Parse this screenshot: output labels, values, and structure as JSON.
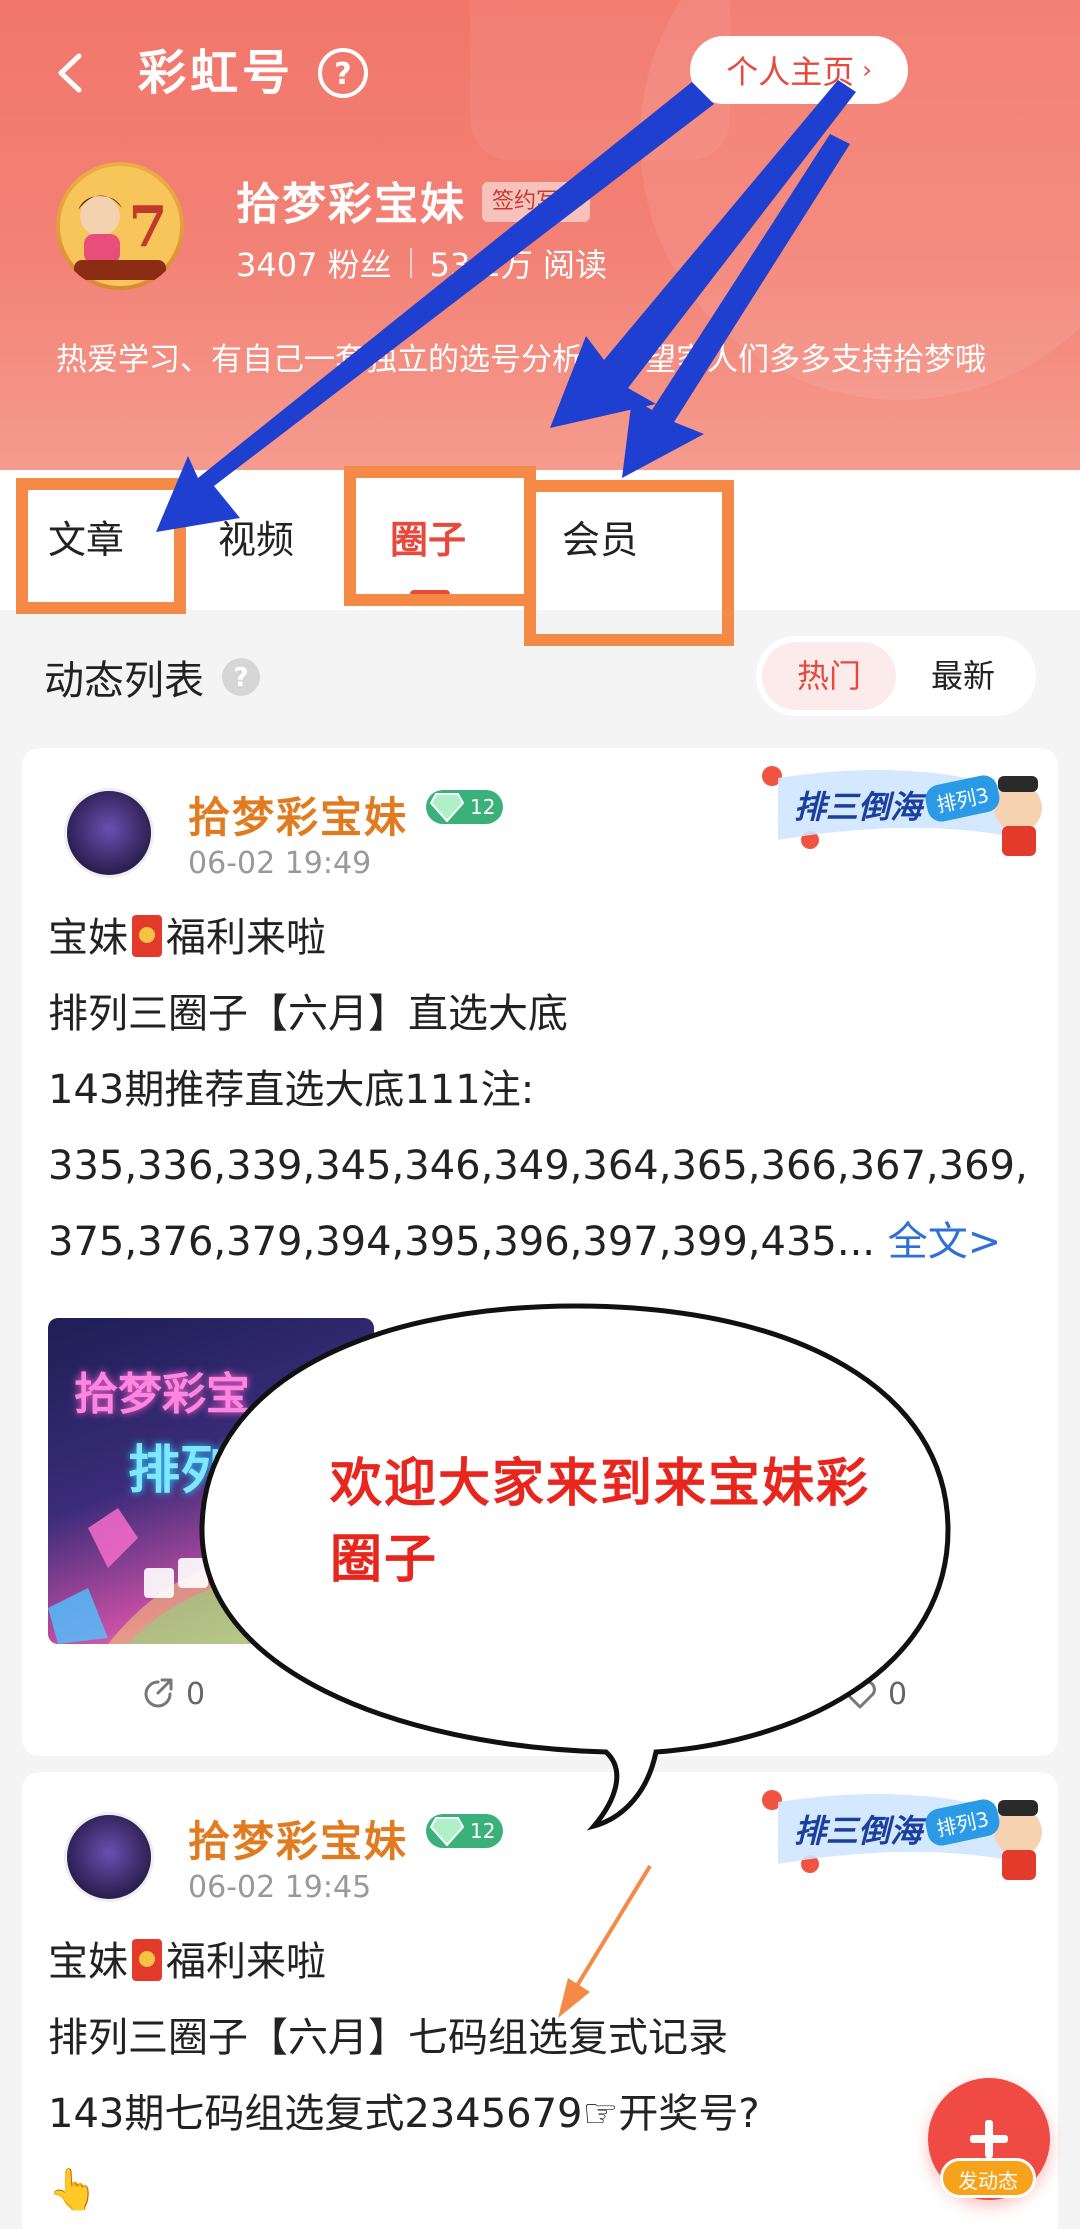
{
  "header": {
    "title": "彩虹号",
    "home_button": "个人主页",
    "home_chevron": "›",
    "author_name": "拾梦彩宝妹",
    "badge": "签约写手",
    "fans": "3407 粉丝",
    "reads": "53.1万 阅读",
    "bio": "热爱学习、有自己一套独立的选号分析、希望家人们多多支持拾梦哦"
  },
  "tabs": [
    {
      "label": "文章",
      "active": false
    },
    {
      "label": "视频",
      "active": false
    },
    {
      "label": "圈子",
      "active": true
    },
    {
      "label": "会员",
      "active": false
    }
  ],
  "feed": {
    "title": "动态列表",
    "sort_options": [
      "热门",
      "最新"
    ],
    "sort_selected": "热门"
  },
  "posts": [
    {
      "author": "拾梦彩宝妹",
      "level": "12",
      "time": "06-02 19:49",
      "banner_text": "排三倒海",
      "banner_pill": "排列3",
      "line1a": "宝妹",
      "line1b": "福利来啦",
      "line2": "排列三圈子【六月】直选大底",
      "line3": "143期推荐直选大底111注:",
      "line4": "335,336,339,345,346,349,364,365,366,367,369,",
      "line5": "375,376,379,394,395,396,397,399,435...",
      "more": "全文>",
      "image_text1": "拾梦彩宝",
      "image_text2": "排列",
      "shares": "0",
      "likes": "0"
    },
    {
      "author": "拾梦彩宝妹",
      "level": "12",
      "time": "06-02 19:45",
      "banner_text": "排三倒海",
      "banner_pill": "排列3",
      "line1a": "宝妹",
      "line1b": "福利来啦",
      "line2": "排列三圈子【六月】七码组选复式记录",
      "line3": "143期七码组选复式2345679☞开奖号?",
      "line4": "👆"
    }
  ],
  "annotation_bubble": "欢迎大家来到来宝妹彩圈子",
  "fab_label": "发动态",
  "colors": {
    "accent": "#e8493d",
    "header_bg": "#f2766a",
    "annotation_orange": "#f58a47",
    "annotation_blue": "#1f3fd0"
  }
}
